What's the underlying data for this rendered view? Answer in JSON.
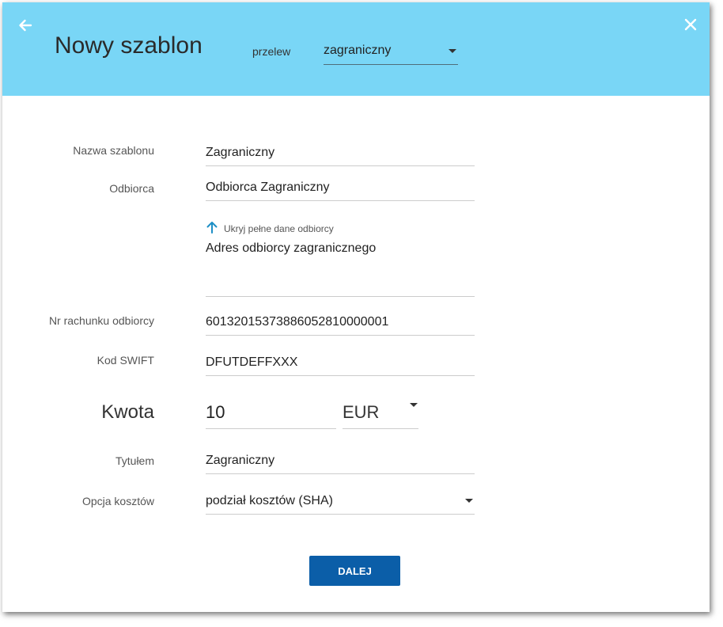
{
  "header": {
    "title": "Nowy szablon",
    "type_label": "przelew",
    "type_value": "zagraniczny",
    "background": "#79d6f6",
    "back_icon": "arrow-left-icon",
    "close_icon": "close-icon"
  },
  "form": {
    "template_name": {
      "label": "Nazwa szablonu",
      "value": "Zagraniczny"
    },
    "recipient": {
      "label": "Odbiorca",
      "value": "Odbiorca Zagraniczny"
    },
    "recipient_toggle": {
      "text": "Ukryj pełne dane odbiorcy",
      "icon": "arrow-up-icon",
      "icon_color": "#1e8fc6"
    },
    "recipient_address": {
      "value": "Adres odbiorcy zagranicznego"
    },
    "account_number": {
      "label": "Nr rachunku odbiorcy",
      "value": "60132015373886052810000001"
    },
    "swift": {
      "label": "Kod SWIFT",
      "value": "DFUTDEFFXXX"
    },
    "amount": {
      "label": "Kwota",
      "value": "10",
      "currency": "EUR"
    },
    "title_field": {
      "label": "Tytułem",
      "value": "Zagraniczny"
    },
    "costs_option": {
      "label": "Opcja kosztów",
      "value": "podział kosztów (SHA)"
    }
  },
  "actions": {
    "next_label": "DALEJ",
    "next_color": "#0b5ea8"
  }
}
